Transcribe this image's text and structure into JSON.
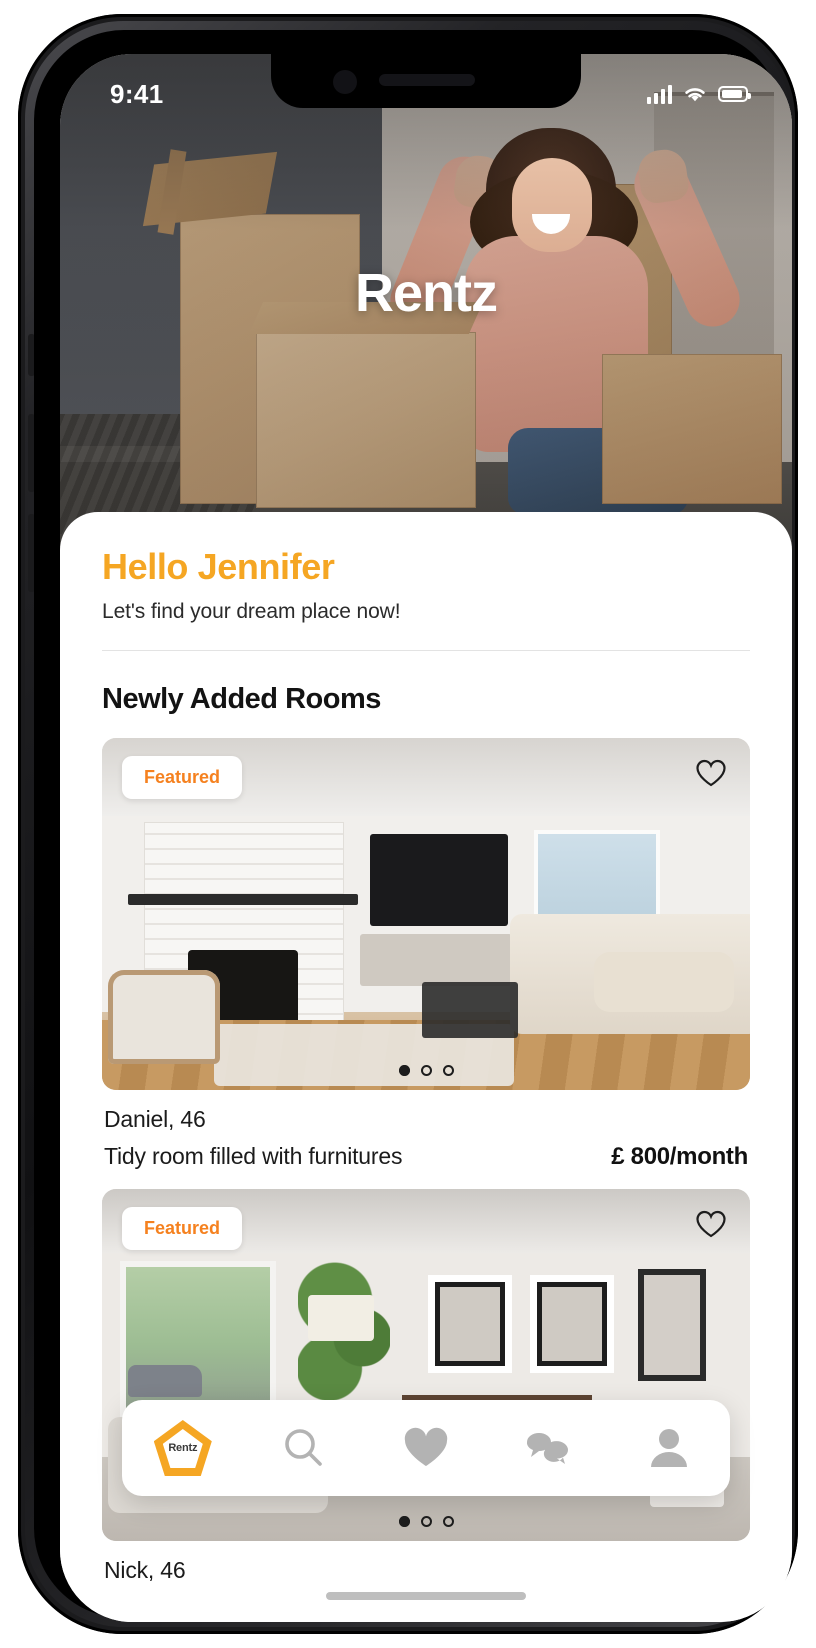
{
  "status_bar": {
    "time": "9:41",
    "signal_icon": "cellular-signal-icon",
    "wifi_icon": "wifi-icon",
    "battery_icon": "battery-icon"
  },
  "hero": {
    "brand": "Rentz",
    "image_alt": "woman-with-moving-boxes"
  },
  "greeting": {
    "title": "Hello Jennifer",
    "subtitle": "Let's find your dream place now!",
    "accent_color": "#f5a623"
  },
  "section": {
    "title": "Newly Added Rooms"
  },
  "listings": [
    {
      "badge": "Featured",
      "owner": "Daniel, 46",
      "description": "Tidy room filled with furnitures",
      "price": "£ 800/month",
      "favorite_icon": "heart-outline-icon",
      "carousel": {
        "count": 3,
        "active": 0
      }
    },
    {
      "badge": "Featured",
      "owner": "Nick, 46",
      "description": "",
      "price": "",
      "favorite_icon": "heart-outline-icon",
      "carousel": {
        "count": 3,
        "active": 0
      }
    }
  ],
  "tabbar": {
    "items": [
      {
        "name": "home",
        "icon": "rentz-pentagon-logo-icon",
        "label": "Rentz",
        "active": true
      },
      {
        "name": "search",
        "icon": "search-icon",
        "label": "",
        "active": false
      },
      {
        "name": "favorites",
        "icon": "heart-filled-icon",
        "label": "",
        "active": false
      },
      {
        "name": "messages",
        "icon": "chat-bubbles-icon",
        "label": "",
        "active": false
      },
      {
        "name": "profile",
        "icon": "person-icon",
        "label": "",
        "active": false
      }
    ],
    "inactive_color": "#b3b3b3",
    "active_color": "#f5a623"
  }
}
